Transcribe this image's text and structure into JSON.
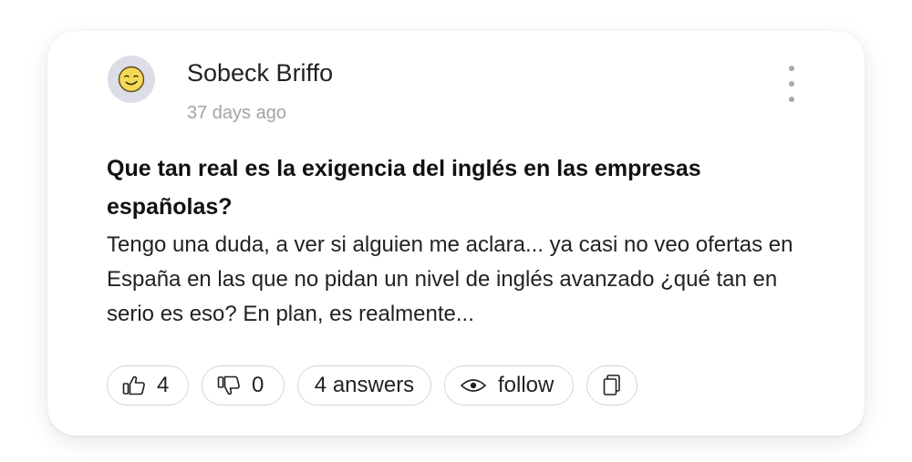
{
  "post": {
    "author": "Sobeck Briffo",
    "time": "37 days ago",
    "avatar_icon": "smirking-face-icon",
    "title": "Que tan real es la exigencia del inglés en las empresas españolas?",
    "body": "Tengo una duda, a ver si alguien me aclara... ya casi no veo ofertas en España en las que no pidan un nivel de inglés avanzado ¿qué tan en serio es eso? En plan, es realmente..."
  },
  "actions": {
    "likes": "4",
    "dislikes": "0",
    "answers_label": "4 answers",
    "follow_label": "follow"
  },
  "colors": {
    "avatar_bg": "#dcdde6",
    "emoji_face": "#f7d959",
    "border": "#d6d6d6",
    "muted": "#a3a3a3"
  }
}
